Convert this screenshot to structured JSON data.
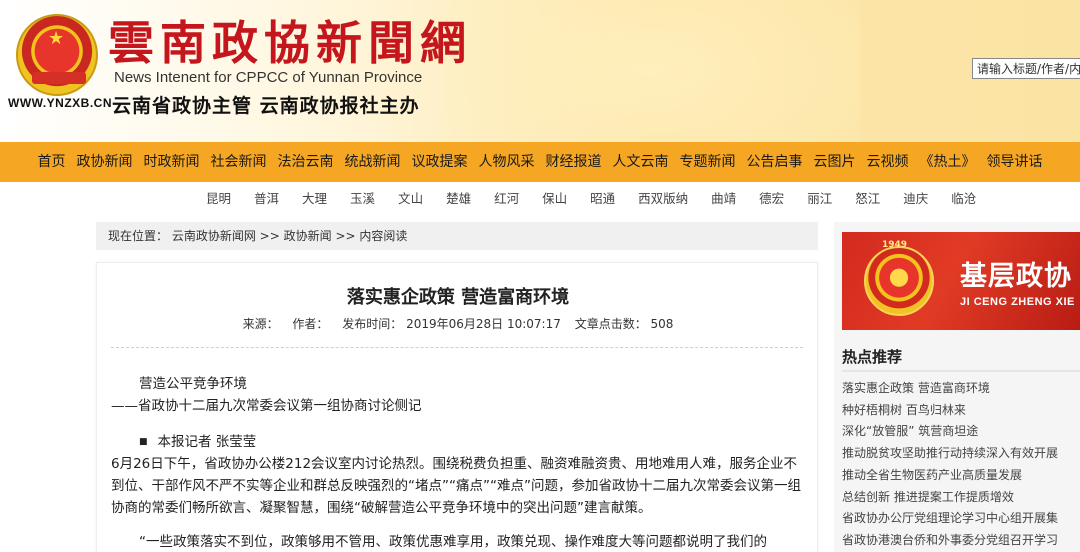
{
  "header": {
    "logo_cn": "雲南政協新聞網",
    "logo_en": "News Intenent for CPPCC of Yunnan Province",
    "site_url": "WWW.YNZXB.CN",
    "subtitle": "云南省政协主管  云南政协报社主办",
    "search_value": "请输入标题/作者/内"
  },
  "nav": {
    "items": [
      "首页",
      "政协新闻",
      "时政新闻",
      "社会新闻",
      "法治云南",
      "统战新闻",
      "议政提案",
      "人物风采",
      "财经报道",
      "人文云南",
      "专题新闻",
      "公告启事",
      "云图片",
      "云视频",
      "《热土》",
      "领导讲话"
    ]
  },
  "regions": {
    "items": [
      "昆明",
      "普洱",
      "大理",
      "玉溪",
      "文山",
      "楚雄",
      "红河",
      "保山",
      "昭通",
      "西双版纳",
      "曲靖",
      "德宏",
      "丽江",
      "怒江",
      "迪庆",
      "临沧"
    ]
  },
  "breadcrumb": {
    "label": "现在位置：",
    "link1": "云南政协新闻网",
    "sep1": " >> ",
    "link2": "政协新闻",
    "sep2": " >> ",
    "current": "内容阅读"
  },
  "article": {
    "title": "落实惠企政策    营造富商环境",
    "meta": {
      "source": "来源：",
      "author": "作者：",
      "publish": "发布时间：  2019年06月28日 10:07:17",
      "clicks": "文章点击数：  508"
    },
    "subtitle": "营造公平竞争环境",
    "subtitle2": "——省政协十二届九次常委会议第一组协商讨论侧记",
    "byline": "本报记者    张莹莹",
    "para1": "6月26日下午，省政协办公楼212会议室内讨论热烈。围绕税费负担重、融资难融资贵、用地难用人难，服务企业不到位、干部作风不严不实等企业和群总反映强烈的“堵点”“痛点”“难点”问题，参加省政协十二届九次常委会议第一组协商的常委们畅所欲言、凝聚智慧，围绕“破解营造公平竞争环境中的突出问题”建言献策。",
    "para2": "“一些政策落实不到位，政策够用不管用、政策优惠难享用，政策兑现、操作难度大等问题都说明了我们的"
  },
  "sidebar": {
    "banner_year": "1949",
    "banner_cn": "基层政协",
    "banner_en": "JI CENG ZHENG XIE",
    "hot_title": "热点推荐",
    "hot_items": [
      "落实惠企政策   营造富商环境",
      "种好梧桐树    百鸟归林来",
      "深化“放管服”    筑营商坦途",
      "推动脱贫攻坚助推行动持续深入有效开展",
      "推动全省生物医药产业高质量发展",
      "总结创新    推进提案工作提质增效",
      "省政协办公厅党组理论学习中心组开展集",
      "省政协港澳台侨和外事委分党组召开学习"
    ]
  },
  "colors": {
    "nav_bg": "#f5a623",
    "logo_red": "#c4161c",
    "banner_red": "#d22a1f"
  }
}
